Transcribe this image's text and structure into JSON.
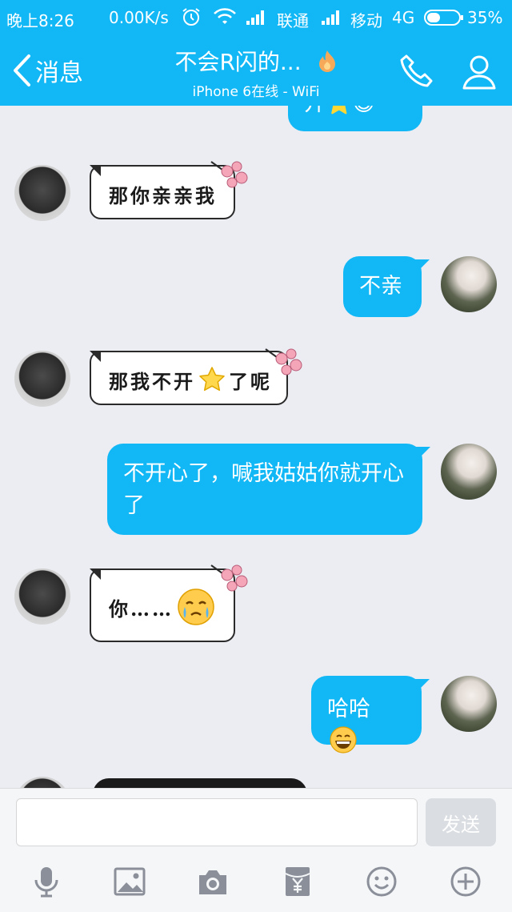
{
  "status_bar": {
    "time": "晚上8:26",
    "speed": "0.00K/s",
    "carrier1": "联通",
    "carrier2": "移动",
    "network": "4G",
    "battery": "35%"
  },
  "nav": {
    "back_label": "消息",
    "title": "不会R闪的...",
    "subtitle": "iPhone 6在线 - WiFi"
  },
  "messages": [
    {
      "side": "out",
      "text": "开⭐😄"
    },
    {
      "side": "in",
      "text": "那你亲亲我"
    },
    {
      "side": "out",
      "text": "不亲"
    },
    {
      "side": "in",
      "text": "那我不开",
      "text_after": "了呢",
      "emoji": "star"
    },
    {
      "side": "out",
      "text": "不开心了，喊我姑姑你就开心了"
    },
    {
      "side": "in",
      "text": "你……",
      "emoji": "crying-face"
    },
    {
      "side": "out",
      "text": "哈哈",
      "emoji": "grin-face"
    }
  ],
  "input": {
    "placeholder": "",
    "send_label": "发送"
  },
  "toolbar": [
    "microphone-icon",
    "image-icon",
    "camera-icon",
    "red-packet-icon",
    "emoji-icon",
    "plus-icon"
  ],
  "colors": {
    "accent": "#12b7f5",
    "background": "#ebedf3"
  }
}
